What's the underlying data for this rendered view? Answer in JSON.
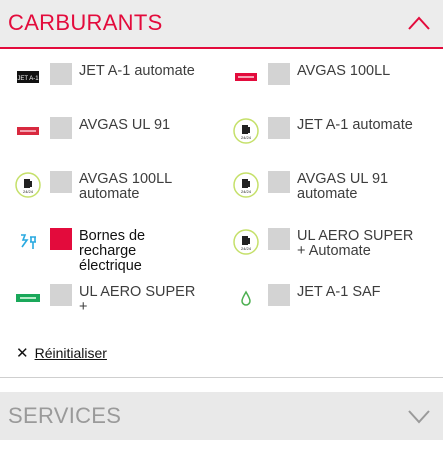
{
  "carburants": {
    "title": "CARBURANTS",
    "expanded": true,
    "accent_color": "#e30b3c",
    "options": [
      {
        "label": "JET A-1 automate",
        "icon": "jet-a1-brand-logo",
        "checked": false
      },
      {
        "label": "AVGAS 100LL",
        "icon": "avgas-brand-logo",
        "checked": false
      },
      {
        "label": "AVGAS UL 91",
        "icon": "avgas-ul91-brand-logo",
        "checked": false
      },
      {
        "label": "JET A-1 automate",
        "icon": "24-7-fuel-pump-icon",
        "checked": false
      },
      {
        "label": "AVGAS 100LL automate",
        "icon": "24-7-fuel-pump-icon",
        "checked": false
      },
      {
        "label": "AVGAS UL 91 automate",
        "icon": "24-7-fuel-pump-icon",
        "checked": false
      },
      {
        "label": "Bornes de recharge électrique",
        "icon": "ev-charging-icon",
        "checked": true
      },
      {
        "label": "UL AERO SUPER + Automate",
        "icon": "24-7-fuel-pump-icon",
        "checked": false
      },
      {
        "label": "UL AERO SUPER +",
        "icon": "ul-aero-brand-logo",
        "checked": false
      },
      {
        "label": "JET A-1 SAF",
        "icon": "saf-drop-icon",
        "checked": false
      }
    ],
    "reset_label": "Réinitialiser"
  },
  "services": {
    "title": "SERVICES",
    "expanded": false
  }
}
